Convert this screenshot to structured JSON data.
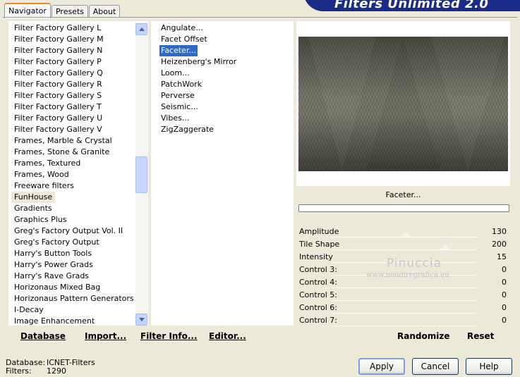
{
  "tabs": [
    "Navigator",
    "Presets",
    "About"
  ],
  "logo": "Filters Unlimited 2.0",
  "categories": [
    "Filter Factory Gallery L",
    "Filter Factory Gallery M",
    "Filter Factory Gallery N",
    "Filter Factory Gallery P",
    "Filter Factory Gallery Q",
    "Filter Factory Gallery R",
    "Filter Factory Gallery S",
    "Filter Factory Gallery T",
    "Filter Factory Gallery U",
    "Filter Factory Gallery V",
    "Frames, Marble & Crystal",
    "Frames, Stone & Granite",
    "Frames, Textured",
    "Frames, Wood",
    "Freeware filters",
    "FunHouse",
    "Gradients",
    "Graphics Plus",
    "Greg's Factory Output Vol. II",
    "Greg's Factory Output",
    "Harry's Button Tools",
    "Harry's Power Grads",
    "Harry's Rave Grads",
    "Horizonaus Mixed Bag",
    "Horizonaus Pattern Generators",
    "I-Decay",
    "Image Enhancement"
  ],
  "selected_category": "FunHouse",
  "filters": [
    "Angulate...",
    "Facet Offset",
    "Faceter...",
    "Heizenberg's Mirror",
    "Loom...",
    "PatchWork",
    "Perverse",
    "Seismic...",
    "Vibes...",
    "ZigZaggerate"
  ],
  "selected_filter": "Faceter...",
  "bottom_links": {
    "database": "Database",
    "import": "Import...",
    "filter_info": "Filter Info...",
    "editor": "Editor..."
  },
  "preview_title": "Faceter...",
  "params": [
    {
      "label": "Amplitude",
      "value": "130"
    },
    {
      "label": "Tile Shape",
      "value": "200"
    },
    {
      "label": "Intensity",
      "value": "15"
    },
    {
      "label": "Control 3:",
      "value": "0"
    },
    {
      "label": "Control 4:",
      "value": "0"
    },
    {
      "label": "Control 5:",
      "value": "0"
    },
    {
      "label": "Control 6:",
      "value": "0"
    },
    {
      "label": "Control 7:",
      "value": "0"
    }
  ],
  "randomize": "Randomize",
  "reset": "Reset",
  "status": {
    "database_label": "Database:",
    "database_value": "ICNET-Filters",
    "filters_label": "Filters:",
    "filters_value": "1290"
  },
  "buttons": {
    "apply": "Apply",
    "cancel": "Cancel",
    "help": "Help"
  },
  "watermark": {
    "name": "Pinuccia",
    "url": "www.maidiregrafica.eu"
  },
  "colors": {
    "selection": "#316ac5",
    "logo_bg": "#1a2c87",
    "dialog_bg": "#ece9d8"
  }
}
